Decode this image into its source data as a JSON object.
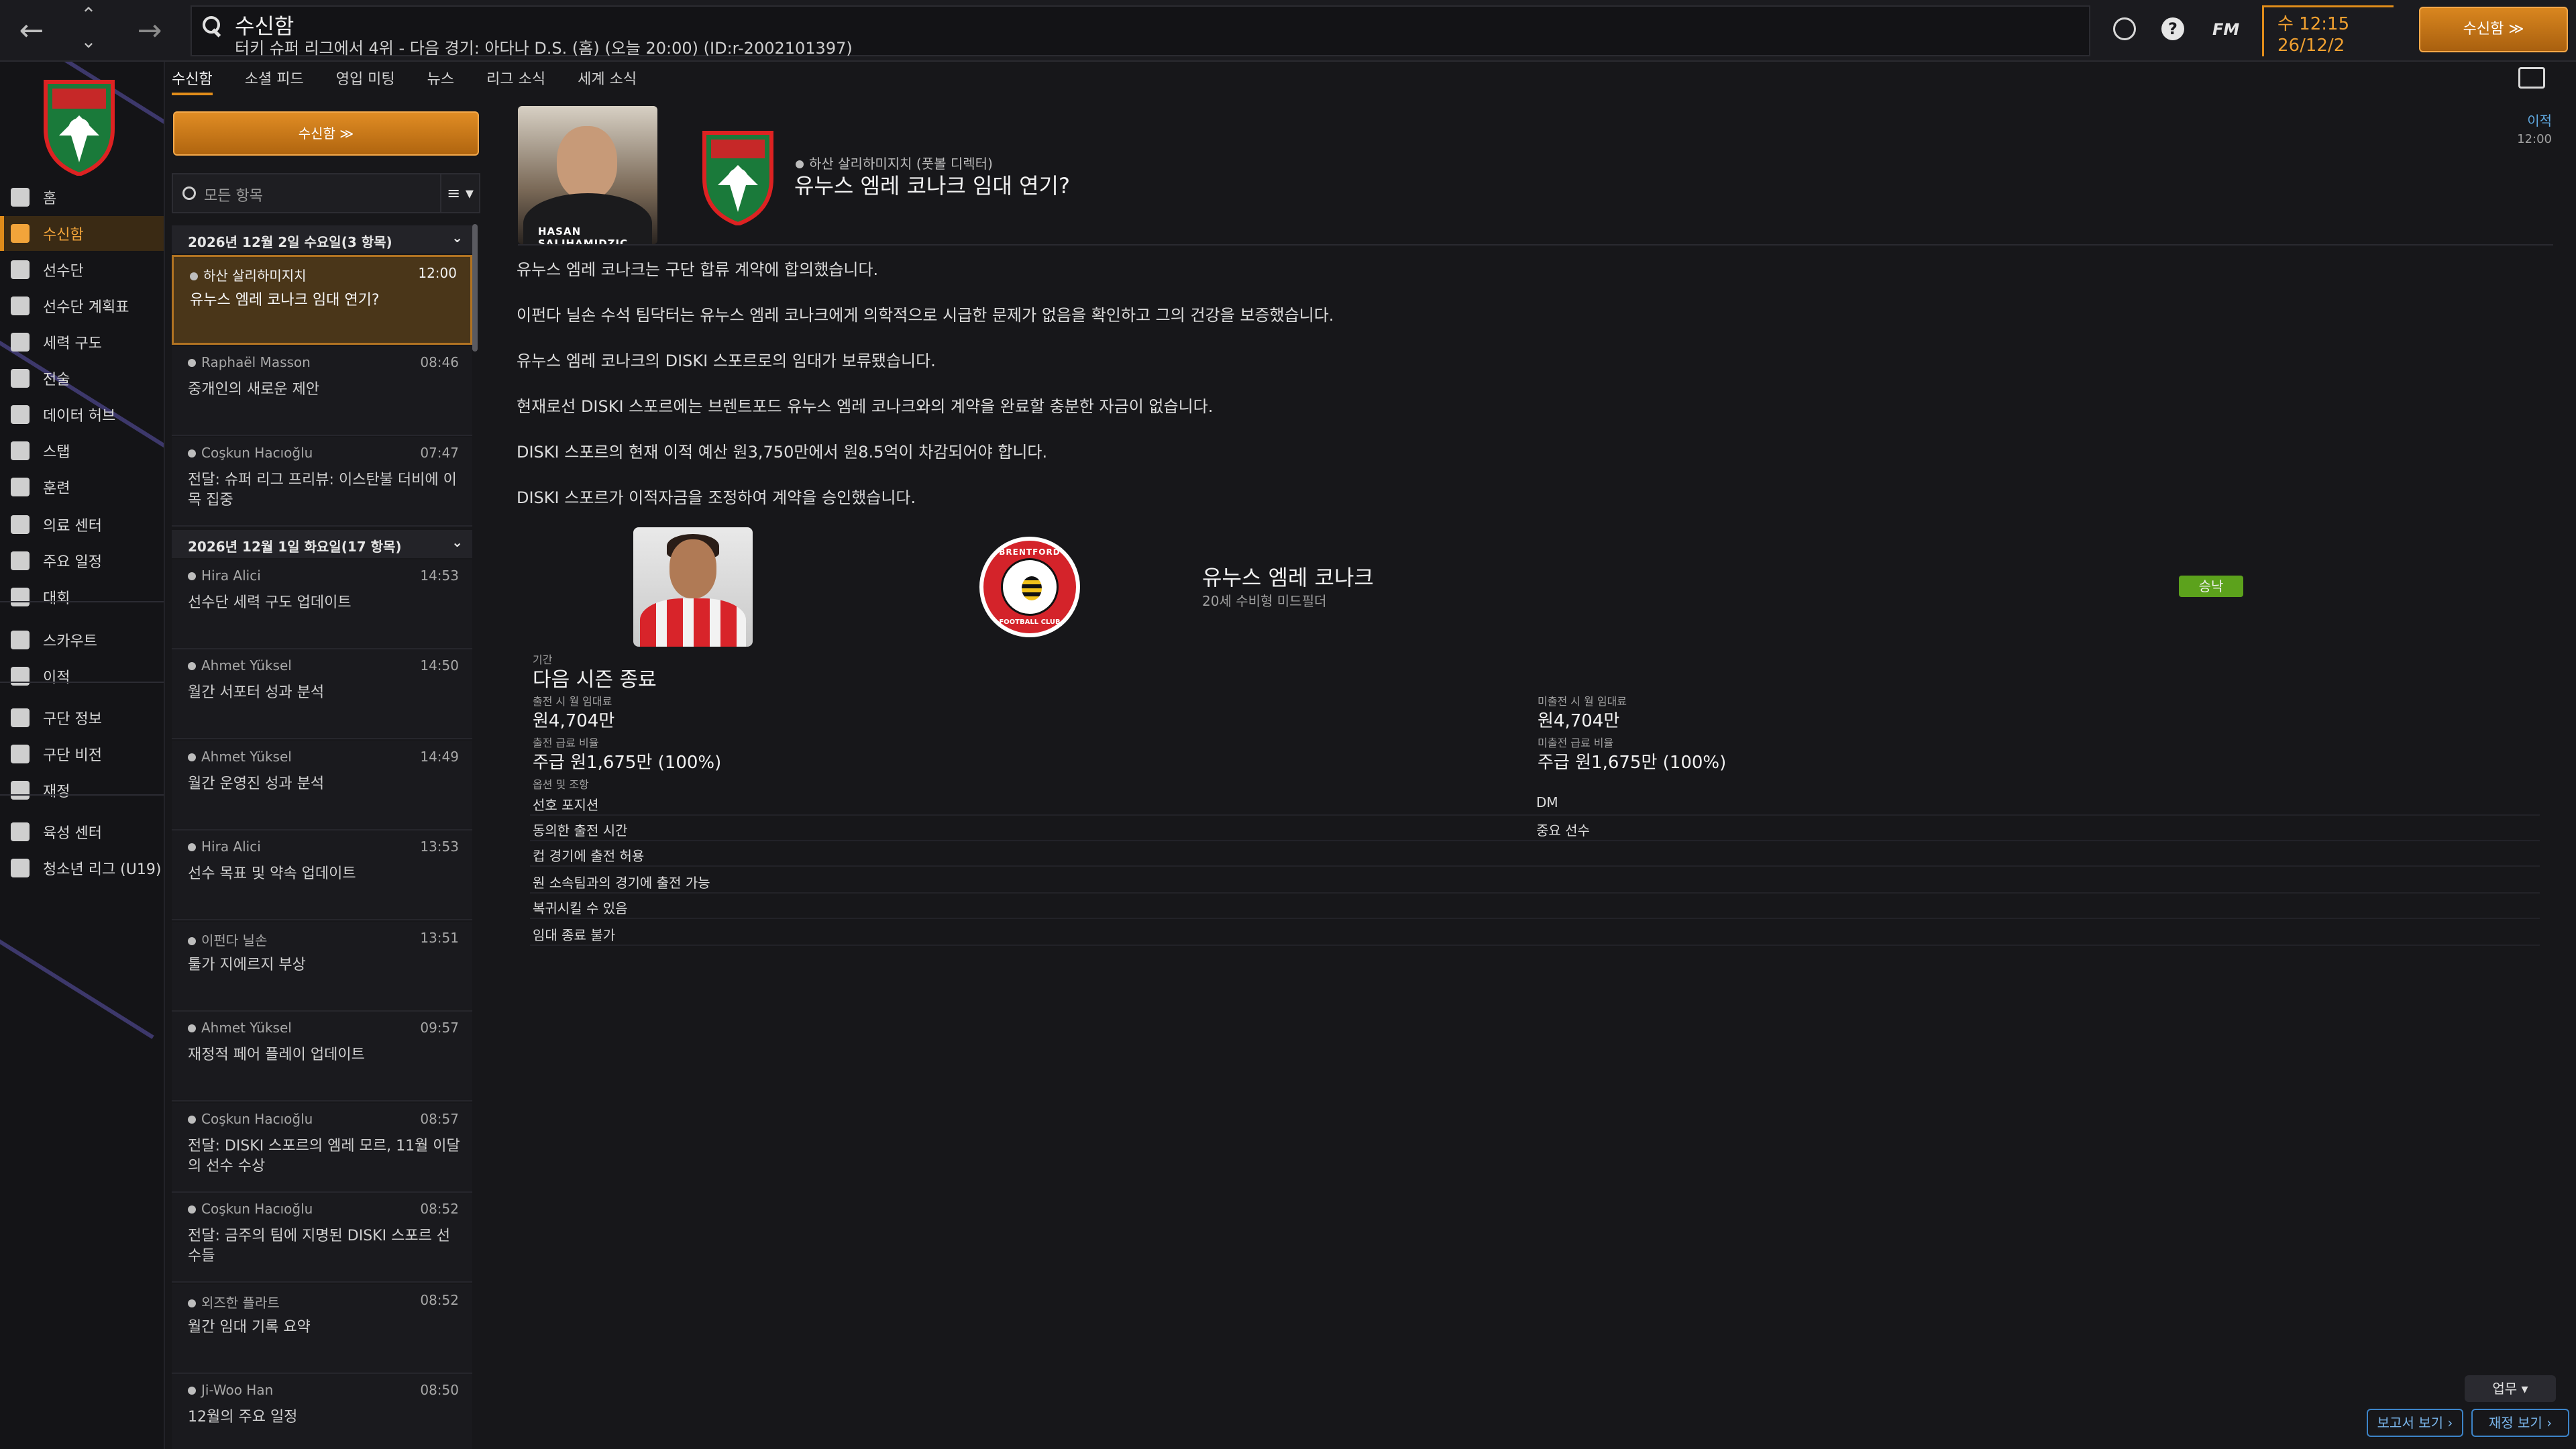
{
  "topbar": {
    "page_title": "수신함",
    "page_subtitle": "터키 슈퍼 리그에서 4위 - 다음 경기: 아다나 D.S. (홈) (오늘 20:00) (ID:r-2002101397)",
    "fm_logo": "FM",
    "date_time": "수 12:15",
    "date_date": "26/12/2",
    "continue_label": "수신함 ≫"
  },
  "sidebar": {
    "items": [
      {
        "label": "홈",
        "icon": "home-icon"
      },
      {
        "label": "수신함",
        "icon": "inbox-icon",
        "active": true
      },
      {
        "label": "선수단",
        "icon": "shirt-icon"
      },
      {
        "label": "선수단 계획표",
        "icon": "clipboard-icon"
      },
      {
        "label": "세력 구도",
        "icon": "dynamics-icon"
      },
      {
        "label": "전술",
        "icon": "tactics-icon"
      },
      {
        "label": "데이터 허브",
        "icon": "data-hub-icon"
      },
      {
        "label": "스탭",
        "icon": "staff-icon"
      },
      {
        "label": "훈련",
        "icon": "training-icon"
      },
      {
        "label": "의료 센터",
        "icon": "medical-icon"
      },
      {
        "label": "주요 일정",
        "icon": "calendar-icon"
      },
      {
        "label": "대회",
        "icon": "trophy-icon"
      },
      {
        "label": "스카우트",
        "icon": "scout-icon"
      },
      {
        "label": "이적",
        "icon": "transfer-icon"
      },
      {
        "label": "구단 정보",
        "icon": "club-info-icon"
      },
      {
        "label": "구단 비전",
        "icon": "vision-icon"
      },
      {
        "label": "재정",
        "icon": "finance-icon"
      },
      {
        "label": "육성 센터",
        "icon": "development-icon"
      },
      {
        "label": "청소년 리그 (U19)",
        "icon": "youth-icon"
      }
    ]
  },
  "tabs": [
    "수신함",
    "소셜 피드",
    "영입 미팅",
    "뉴스",
    "리그 소식",
    "세계 소식"
  ],
  "inbox": {
    "continue_label": "수신함 ≫",
    "search_placeholder": "모든 항목",
    "filter_icon": "≡ ▾",
    "groups": [
      {
        "header": "2026년 12월 2일 수요일(3 항목)"
      },
      {
        "header": "2026년 12월 1일 화요일(17 항목)"
      }
    ],
    "messages": [
      {
        "from": "하산 살리하미지치",
        "time": "12:00",
        "subject": "유누스 엠레 코나크 임대 연기?",
        "selected": true
      },
      {
        "from": "Raphaël Masson",
        "time": "08:46",
        "subject": "중개인의 새로운 제안"
      },
      {
        "from": "Coşkun Hacıoğlu",
        "time": "07:47",
        "subject": "전달: 슈퍼 리그 프리뷰: 이스탄불 더비에 이목 집중"
      },
      {
        "from": "Hira Alici",
        "time": "14:53",
        "subject": "선수단 세력 구도 업데이트"
      },
      {
        "from": "Ahmet Yüksel",
        "time": "14:50",
        "subject": "월간 서포터 성과 분석"
      },
      {
        "from": "Ahmet Yüksel",
        "time": "14:49",
        "subject": "월간 운영진 성과 분석"
      },
      {
        "from": "Hira Alici",
        "time": "13:53",
        "subject": "선수 목표 및 약속 업데이트"
      },
      {
        "from": "이펀다 닐손",
        "time": "13:51",
        "subject": "툴가 지에르지 부상"
      },
      {
        "from": "Ahmet Yüksel",
        "time": "09:57",
        "subject": "재정적 페어 플레이 업데이트"
      },
      {
        "from": "Coşkun Hacıoğlu",
        "time": "08:57",
        "subject": "전달: DISKI 스포르의 엠레 모르, 11월 이달의 선수 수상"
      },
      {
        "from": "Coşkun Hacıoğlu",
        "time": "08:52",
        "subject": "전달: 금주의 팀에 지명된 DISKI 스포르 선수들"
      },
      {
        "from": "외즈한 플라트",
        "time": "08:52",
        "subject": "월간 임대 기록 요약"
      },
      {
        "from": "Ji-Woo Han",
        "time": "08:50",
        "subject": "12월의 주요 일정"
      }
    ]
  },
  "message": {
    "sender_caption": "HASAN SALIHAMIDZIC",
    "from": "하산 살리하미지치 (풋볼 디렉터)",
    "title": "유누스 엠레 코나크 임대 연기?",
    "when_label": "이적",
    "when_time": "12:00",
    "body": [
      "유누스 엠레 코나크는 구단 합류 계약에 합의했습니다.",
      "이펀다 닐손 수석 팀닥터는 유누스 엠레 코나크에게 의학적으로 시급한 문제가 없음을 확인하고 그의 건강을 보증했습니다.",
      "유누스 엠레 코나크의 DISKI 스포르로의 임대가 보류됐습니다.",
      "현재로선 DISKI 스포르에는 브렌트포드 유누스 엠레 코나크와의 계약을 완료할 충분한 자금이 없습니다.",
      "DISKI 스포르의 현재 이적 예산 원3,750만에서 원8.5억이 차감되어야 합니다.",
      "DISKI 스포르가 이적자금을 조정하여 계약을 승인했습니다."
    ],
    "player": {
      "name": "유누스 엠레 코나크",
      "description": "20세 수비형 미드필더",
      "club_top": "BRENTFORD",
      "club_bottom": "FOOTBALL CLUB",
      "status": "승낙"
    },
    "terms": {
      "period_label": "기간",
      "period_value": "다음 시즌 종료",
      "fee_played_label": "출전 시 월 임대료",
      "fee_played_value": "원4,704만",
      "fee_unplayed_label": "미출전 시 월 임대료",
      "fee_unplayed_value": "원4,704만",
      "wage_played_label": "출전 급료 비율",
      "wage_played_value": "주급 원1,675만 (100%)",
      "wage_unplayed_label": "미출전 급료 비율",
      "wage_unplayed_value": "주급 원1,675만 (100%)",
      "options_label": "옵션 및 조항"
    },
    "options": [
      {
        "key": "선호 포지션",
        "value": "DM"
      },
      {
        "key": "동의한 출전 시간",
        "value": "중요 선수"
      },
      {
        "key": "컵 경기에 출전 허용",
        "value": ""
      },
      {
        "key": "원 소속팀과의 경기에 출전 가능",
        "value": ""
      },
      {
        "key": "복귀시킬 수 있음",
        "value": ""
      },
      {
        "key": "임대 종료 불가",
        "value": ""
      }
    ]
  },
  "footer": {
    "role_label": "업무 ▾",
    "report_label": "보고서 보기 ›",
    "finance_label": "재정 보기 ›"
  },
  "colors": {
    "accent": "#e08c1a",
    "success": "#5ca21c",
    "link": "#7ab6ec"
  }
}
